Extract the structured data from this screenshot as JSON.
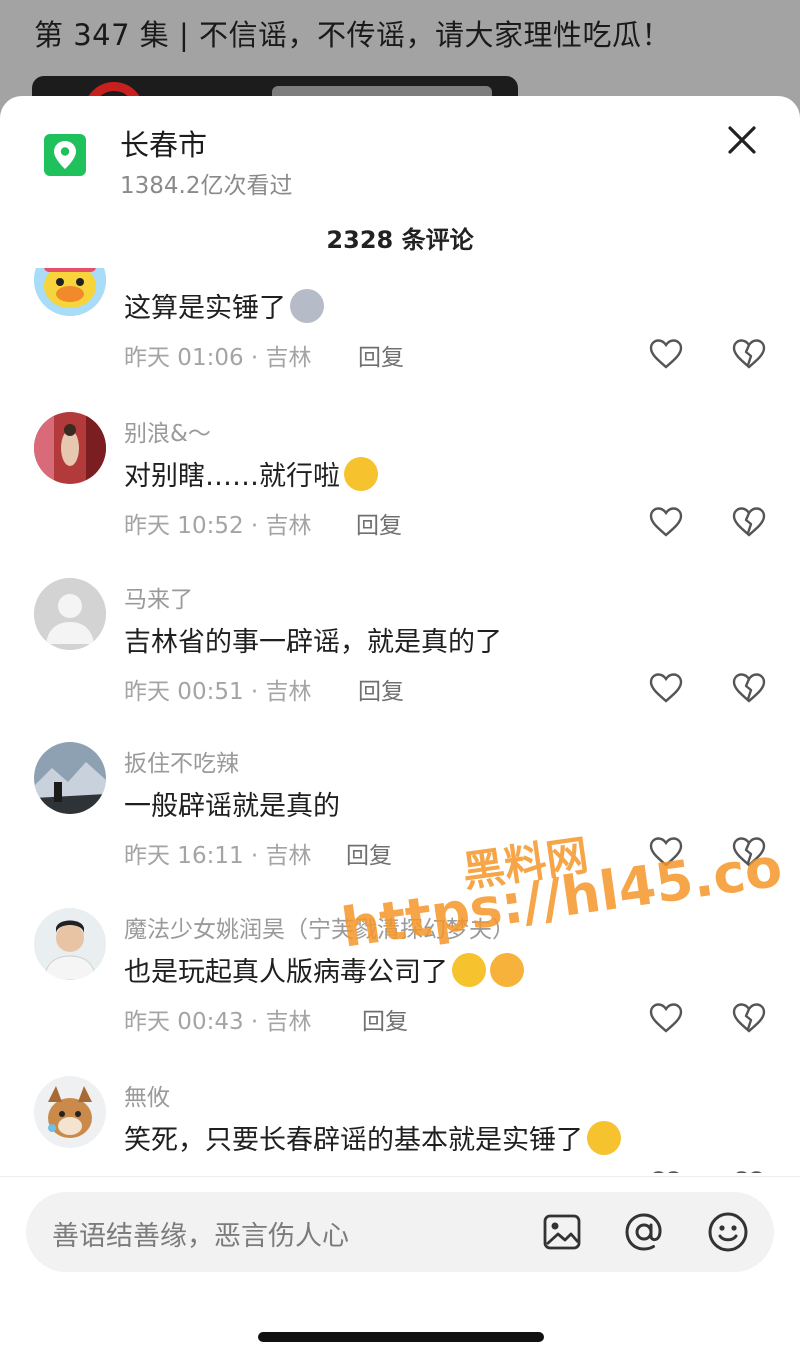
{
  "background": {
    "video_title": "第 347 集 | 不信谣，不传谣，请大家理性吃瓜！"
  },
  "location": {
    "icon": "location-pin-icon",
    "name": "长春市",
    "views": "1384.2亿次看过"
  },
  "comment_count": "2328 条评论",
  "comments": [
    {
      "user": "",
      "text": "这算是实锤了",
      "time": "昨天 01:06 · 吉林",
      "reply": "回复",
      "emoji": [
        "husky-emoji"
      ]
    },
    {
      "user": "别浪&～",
      "text": "对别瞎……就行啦",
      "time": "昨天 10:52 · 吉林",
      "reply": "回复",
      "emoji": [
        "rofl-emoji"
      ]
    },
    {
      "user": "马来了",
      "text": "吉林省的事一辟谣，就是真的了",
      "time": "昨天 00:51 · 吉林",
      "reply": "回复",
      "emoji": []
    },
    {
      "user": "扳住不吃辣",
      "text": "一般辟谣就是真的",
      "time": "昨天 16:11 · 吉林",
      "reply": "回复",
      "emoji": []
    },
    {
      "user": "魔法少女姚润昊（宁芙戮清探幻梦夫）",
      "text": "也是玩起真人版病毒公司了",
      "time": "昨天 00:43 · 吉林",
      "reply": "回复",
      "emoji": [
        "rofl-emoji",
        "ok-hand-emoji"
      ]
    },
    {
      "user": "無攸",
      "text": "笑死，只要长春辟谣的基本就是实锤了",
      "time": "",
      "reply": "",
      "emoji": [
        "thinking-emoji"
      ]
    }
  ],
  "input": {
    "placeholder": "善语结善缘，恶言伤人心"
  },
  "watermark": {
    "line1": "黑料网",
    "line2": "https://hl45.co"
  },
  "colors": {
    "accent_green": "#1ec15c",
    "watermark": "#f59628"
  }
}
